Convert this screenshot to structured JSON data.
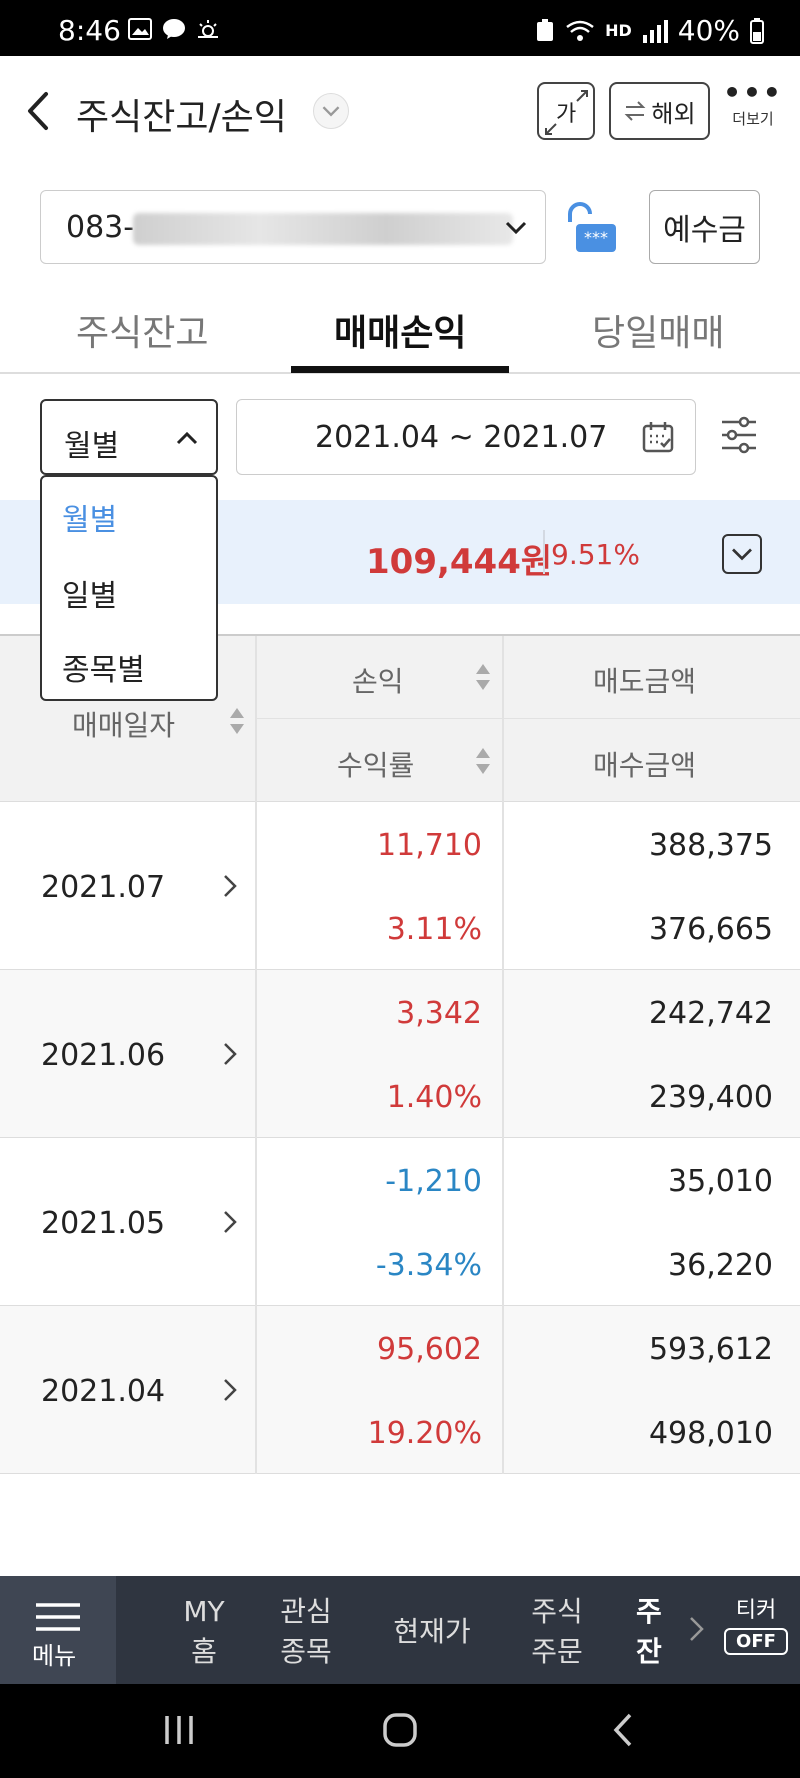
{
  "status_bar": {
    "time": "8:46",
    "battery": "40%",
    "hd_label": "HD"
  },
  "header": {
    "back_label": "<",
    "title": "주식잔고/손익",
    "font_button_label": "가",
    "overseas_button_label": "해외",
    "more_label": "더보기"
  },
  "account": {
    "number_prefix": "083-",
    "deposit_button_label": "예수금"
  },
  "tabs": [
    {
      "label": "주식잔고",
      "active": false
    },
    {
      "label": "매매손익",
      "active": true
    },
    {
      "label": "당일매매",
      "active": false
    }
  ],
  "filter": {
    "period_selected": "월별",
    "period_options": [
      "월별",
      "일별",
      "종목별"
    ],
    "date_range": "2021.04 ~ 2021.07"
  },
  "summary": {
    "profit_amount": "109,444원",
    "profit_rate": "9.51%"
  },
  "table": {
    "headers": {
      "date": "매매일자",
      "profit": "손익",
      "rate": "수익률",
      "sell_amount": "매도금액",
      "buy_amount": "매수금액"
    },
    "rows": [
      {
        "date": "2021.07",
        "profit": "11,710",
        "rate": "3.11%",
        "sell": "388,375",
        "buy": "376,665",
        "sign": "positive"
      },
      {
        "date": "2021.06",
        "profit": "3,342",
        "rate": "1.40%",
        "sell": "242,742",
        "buy": "239,400",
        "sign": "positive"
      },
      {
        "date": "2021.05",
        "profit": "-1,210",
        "rate": "-3.34%",
        "sell": "35,010",
        "buy": "36,220",
        "sign": "negative"
      },
      {
        "date": "2021.04",
        "profit": "95,602",
        "rate": "19.20%",
        "sell": "593,612",
        "buy": "498,010",
        "sign": "positive"
      }
    ]
  },
  "bottom_nav": {
    "menu_label": "메뉴",
    "items": [
      {
        "line1": "MY",
        "line2": "홈"
      },
      {
        "line1": "관심",
        "line2": "종목"
      },
      {
        "line1": "현재가",
        "line2": ""
      },
      {
        "line1": "주식",
        "line2": "주문"
      }
    ],
    "clipped_item": {
      "line1": "주",
      "line2": "잔"
    },
    "ticker_label": "티커",
    "ticker_state": "OFF"
  },
  "colors": {
    "profit": "#d03a3a",
    "loss": "#2a86c4",
    "accent": "#4a90e2",
    "summary_bg": "#e8f1fc"
  }
}
